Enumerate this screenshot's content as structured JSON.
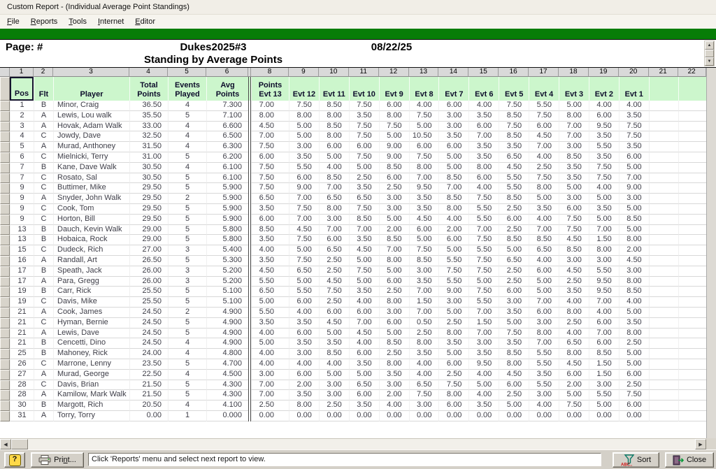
{
  "window": {
    "title": "Custom Report - (Individual Average Point Standings)"
  },
  "menu": {
    "items": [
      {
        "label": "File"
      },
      {
        "label": "Reports"
      },
      {
        "label": "Tools"
      },
      {
        "label": "Internet"
      },
      {
        "label": "Editor"
      }
    ]
  },
  "report_header": {
    "page_label": "Page: #",
    "title": "Dukes2025#3",
    "date": "08/22/25",
    "subtitle": "Standing by Average Points"
  },
  "grid": {
    "column_numbers": [
      "1",
      "2",
      "3",
      "4",
      "5",
      "6",
      "8",
      "9",
      "10",
      "11",
      "12",
      "13",
      "14",
      "15",
      "16",
      "17",
      "18",
      "19",
      "20",
      "21",
      "22"
    ],
    "headers": [
      "Pos",
      "Flt",
      "Player",
      "Total\nPoints",
      "Events\nPlayed",
      "Avg\nPoints",
      "Points\nEvt 13",
      "Evt 12",
      "Evt 11",
      "Evt 10",
      "Evt 9",
      "Evt 8",
      "Evt 7",
      "Evt 6",
      "Evt 5",
      "Evt 4",
      "Evt 3",
      "Evt 2",
      "Evt 1",
      "",
      ""
    ],
    "rows": [
      [
        "1",
        "B",
        "Minor, Craig",
        "36.50",
        "4",
        "7.300",
        "7.00",
        "7.50",
        "8.50",
        "7.50",
        "6.00",
        "4.00",
        "6.00",
        "4.00",
        "7.50",
        "5.50",
        "5.00",
        "4.00",
        "4.00"
      ],
      [
        "2",
        "A",
        "Lewis, Lou walk",
        "35.50",
        "5",
        "7.100",
        "8.00",
        "8.00",
        "8.00",
        "3.50",
        "8.00",
        "7.50",
        "3.00",
        "3.50",
        "8.50",
        "7.50",
        "8.00",
        "6.00",
        "3.50"
      ],
      [
        "3",
        "A",
        "Hovak, Adam Walk",
        "33.00",
        "4",
        "6.600",
        "4.50",
        "5.00",
        "8.50",
        "7.50",
        "7.50",
        "5.00",
        "3.00",
        "6.00",
        "7.50",
        "6.00",
        "7.00",
        "9.50",
        "7.50"
      ],
      [
        "4",
        "C",
        "Jowdy, Dave",
        "32.50",
        "4",
        "6.500",
        "7.00",
        "5.00",
        "8.00",
        "7.50",
        "5.00",
        "10.50",
        "3.50",
        "7.00",
        "8.50",
        "4.50",
        "7.00",
        "3.50",
        "7.50"
      ],
      [
        "5",
        "A",
        "Murad, Anthoney",
        "31.50",
        "4",
        "6.300",
        "7.50",
        "3.00",
        "6.00",
        "6.00",
        "9.00",
        "6.00",
        "6.00",
        "3.50",
        "3.50",
        "7.00",
        "3.00",
        "5.50",
        "3.50"
      ],
      [
        "6",
        "C",
        "Mielnicki, Terry",
        "31.00",
        "5",
        "6.200",
        "6.00",
        "3.50",
        "5.00",
        "7.50",
        "9.00",
        "7.50",
        "5.00",
        "3.50",
        "6.50",
        "4.00",
        "8.50",
        "3.50",
        "6.00"
      ],
      [
        "7",
        "B",
        "Kane, Dave Walk",
        "30.50",
        "4",
        "6.100",
        "7.50",
        "5.50",
        "4.00",
        "5.00",
        "8.50",
        "8.00",
        "5.00",
        "8.00",
        "4.50",
        "2.50",
        "3.50",
        "7.50",
        "5.00"
      ],
      [
        "7",
        "C",
        "Rosato, Sal",
        "30.50",
        "5",
        "6.100",
        "7.50",
        "6.00",
        "8.50",
        "2.50",
        "6.00",
        "7.00",
        "8.50",
        "6.00",
        "5.50",
        "7.50",
        "3.50",
        "7.50",
        "7.00"
      ],
      [
        "9",
        "C",
        "Buttimer, Mike",
        "29.50",
        "5",
        "5.900",
        "7.50",
        "9.00",
        "7.00",
        "3.50",
        "2.50",
        "9.50",
        "7.00",
        "4.00",
        "5.50",
        "8.00",
        "5.00",
        "4.00",
        "9.00"
      ],
      [
        "9",
        "A",
        "Snyder, John Walk",
        "29.50",
        "2",
        "5.900",
        "6.50",
        "7.00",
        "6.50",
        "6.50",
        "3.00",
        "3.50",
        "8.50",
        "7.50",
        "8.50",
        "5.00",
        "3.00",
        "5.00",
        "3.00"
      ],
      [
        "9",
        "C",
        "Cook, Tom",
        "29.50",
        "5",
        "5.900",
        "3.50",
        "7.50",
        "8.00",
        "7.50",
        "3.00",
        "3.50",
        "8.00",
        "5.50",
        "2.50",
        "3.50",
        "6.00",
        "3.50",
        "5.00"
      ],
      [
        "9",
        "C",
        "Horton, Bill",
        "29.50",
        "5",
        "5.900",
        "6.00",
        "7.00",
        "3.00",
        "8.50",
        "5.00",
        "4.50",
        "4.00",
        "5.50",
        "6.00",
        "4.00",
        "7.50",
        "5.00",
        "8.50"
      ],
      [
        "13",
        "B",
        "Dauch, Kevin Walk",
        "29.00",
        "5",
        "5.800",
        "8.50",
        "4.50",
        "7.00",
        "7.00",
        "2.00",
        "6.00",
        "2.00",
        "7.00",
        "2.50",
        "7.00",
        "7.50",
        "7.00",
        "5.00"
      ],
      [
        "13",
        "B",
        "Hobaica, Rock",
        "29.00",
        "5",
        "5.800",
        "3.50",
        "7.50",
        "6.00",
        "3.50",
        "8.50",
        "5.00",
        "6.00",
        "7.50",
        "8.50",
        "8.50",
        "4.50",
        "1.50",
        "8.00"
      ],
      [
        "15",
        "C",
        "Dudeck, Rich",
        "27.00",
        "3",
        "5.400",
        "4.00",
        "5.00",
        "6.50",
        "4.50",
        "7.00",
        "7.50",
        "5.00",
        "5.50",
        "5.00",
        "6.50",
        "8.50",
        "8.00",
        "2.00"
      ],
      [
        "16",
        "A",
        "Randall, Art",
        "26.50",
        "5",
        "5.300",
        "3.50",
        "7.50",
        "2.50",
        "5.00",
        "8.00",
        "8.50",
        "5.50",
        "7.50",
        "6.50",
        "4.00",
        "3.00",
        "3.00",
        "4.50"
      ],
      [
        "17",
        "B",
        "Speath, Jack",
        "26.00",
        "3",
        "5.200",
        "4.50",
        "6.50",
        "2.50",
        "7.50",
        "5.00",
        "3.00",
        "7.50",
        "7.50",
        "2.50",
        "6.00",
        "4.50",
        "5.50",
        "3.00"
      ],
      [
        "17",
        "A",
        "Para, Gregg",
        "26.00",
        "3",
        "5.200",
        "5.50",
        "5.00",
        "4.50",
        "5.00",
        "6.00",
        "3.50",
        "5.50",
        "5.00",
        "2.50",
        "5.00",
        "2.50",
        "9.50",
        "8.00"
      ],
      [
        "19",
        "B",
        "Carr, Rick",
        "25.50",
        "5",
        "5.100",
        "6.50",
        "5.50",
        "7.50",
        "3.50",
        "2.50",
        "7.00",
        "9.00",
        "7.50",
        "6.00",
        "5.00",
        "3.50",
        "9.50",
        "8.50"
      ],
      [
        "19",
        "C",
        "Davis, Mike",
        "25.50",
        "5",
        "5.100",
        "5.00",
        "6.00",
        "2.50",
        "4.00",
        "8.00",
        "1.50",
        "3.00",
        "5.50",
        "3.00",
        "7.00",
        "4.00",
        "7.00",
        "4.00"
      ],
      [
        "21",
        "A",
        "Cook, James",
        "24.50",
        "2",
        "4.900",
        "5.50",
        "4.00",
        "6.00",
        "6.00",
        "3.00",
        "7.00",
        "5.00",
        "7.00",
        "3.50",
        "6.00",
        "8.00",
        "4.00",
        "5.00"
      ],
      [
        "21",
        "C",
        "Hyman, Bernie",
        "24.50",
        "5",
        "4.900",
        "3.50",
        "3.50",
        "4.50",
        "7.00",
        "6.00",
        "0.50",
        "2.50",
        "1.50",
        "5.00",
        "3.00",
        "2.50",
        "6.00",
        "3.50"
      ],
      [
        "21",
        "A",
        "Lewis, Dave",
        "24.50",
        "5",
        "4.900",
        "4.00",
        "6.00",
        "5.00",
        "4.50",
        "5.00",
        "2.50",
        "8.00",
        "7.00",
        "7.50",
        "8.00",
        "4.00",
        "7.00",
        "8.00"
      ],
      [
        "21",
        "B",
        "Cencetti, Dino",
        "24.50",
        "4",
        "4.900",
        "5.00",
        "3.50",
        "3.50",
        "4.00",
        "8.50",
        "8.00",
        "3.50",
        "3.00",
        "3.50",
        "7.00",
        "6.50",
        "6.00",
        "2.50"
      ],
      [
        "25",
        "B",
        "Mahoney, Rick",
        "24.00",
        "4",
        "4.800",
        "4.00",
        "3.00",
        "8.50",
        "6.00",
        "2.50",
        "3.50",
        "5.00",
        "3.50",
        "8.50",
        "5.50",
        "8.00",
        "8.50",
        "5.00"
      ],
      [
        "26",
        "C",
        "Marrone, Lenny",
        "23.50",
        "5",
        "4.700",
        "4.00",
        "4.00",
        "4.00",
        "3.50",
        "8.00",
        "4.00",
        "6.00",
        "9.50",
        "8.00",
        "5.50",
        "4.50",
        "1.50",
        "5.00"
      ],
      [
        "27",
        "A",
        "Murad, George",
        "22.50",
        "4",
        "4.500",
        "3.00",
        "6.00",
        "5.00",
        "5.00",
        "3.50",
        "4.00",
        "2.50",
        "4.00",
        "4.50",
        "3.50",
        "6.00",
        "1.50",
        "6.00"
      ],
      [
        "28",
        "C",
        "Davis, Brian",
        "21.50",
        "5",
        "4.300",
        "7.00",
        "2.00",
        "3.00",
        "6.50",
        "3.00",
        "6.50",
        "7.50",
        "5.00",
        "6.00",
        "5.50",
        "2.00",
        "3.00",
        "2.50"
      ],
      [
        "28",
        "A",
        "Kamilow, Mark Walk",
        "21.50",
        "5",
        "4.300",
        "7.00",
        "3.50",
        "3.00",
        "6.00",
        "2.00",
        "7.50",
        "8.00",
        "4.00",
        "2.50",
        "3.00",
        "5.00",
        "5.50",
        "7.50"
      ],
      [
        "30",
        "B",
        "Margott, Rich",
        "20.50",
        "4",
        "4.100",
        "2.50",
        "8.00",
        "2.50",
        "3.50",
        "4.00",
        "3.00",
        "6.00",
        "3.50",
        "5.00",
        "4.00",
        "7.50",
        "5.00",
        "6.00"
      ],
      [
        "31",
        "A",
        "Torry, Torry",
        "0.00",
        "1",
        "0.000",
        "0.00",
        "0.00",
        "0.00",
        "0.00",
        "0.00",
        "0.00",
        "0.00",
        "0.00",
        "0.00",
        "0.00",
        "0.00",
        "0.00",
        "0.00"
      ]
    ]
  },
  "statusbar": {
    "help_icon": "?",
    "print_label": "Print...",
    "message": "Click 'Reports' menu and select next report to view.",
    "sort_label": "Sort",
    "close_label": "Close"
  },
  "icons": {
    "up_arrow": "▲",
    "down_arrow": "▼",
    "left_arrow": "◀",
    "right_arrow": "▶"
  },
  "colors": {
    "green_bar": "#077d07",
    "header_green": "#ccf6cc",
    "chrome": "#d4d0c8"
  }
}
